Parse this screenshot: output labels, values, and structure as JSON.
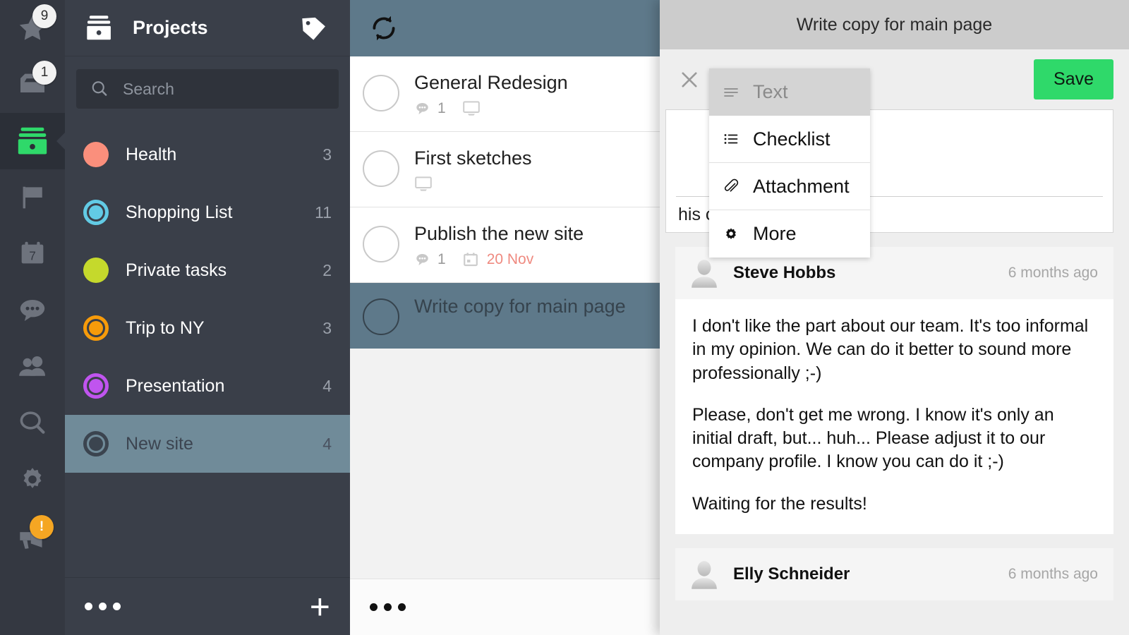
{
  "rail": {
    "items": [
      {
        "name": "starred",
        "icon": "star-icon",
        "badge": "9",
        "badge_type": "count",
        "active": false
      },
      {
        "name": "inbox",
        "icon": "inbox-icon",
        "badge": "1",
        "badge_type": "count",
        "active": false
      },
      {
        "name": "projects",
        "icon": "projects-icon",
        "badge": "",
        "badge_type": "",
        "active": true
      },
      {
        "name": "flags",
        "icon": "flag-icon",
        "badge": "",
        "badge_type": "",
        "active": false
      },
      {
        "name": "calendar",
        "icon": "calendar-icon",
        "badge": "7",
        "badge_type": "inline",
        "active": false
      },
      {
        "name": "chat",
        "icon": "comment-icon",
        "badge": "",
        "badge_type": "",
        "active": false
      },
      {
        "name": "contacts",
        "icon": "people-icon",
        "badge": "",
        "badge_type": "",
        "active": false
      },
      {
        "name": "search",
        "icon": "search-icon",
        "badge": "",
        "badge_type": "",
        "active": false
      },
      {
        "name": "settings",
        "icon": "gear-icon",
        "badge": "",
        "badge_type": "",
        "active": false
      },
      {
        "name": "announcements",
        "icon": "megaphone-icon",
        "badge": "!",
        "badge_type": "warning",
        "active": false
      }
    ],
    "calendar_day": "7"
  },
  "sidebar": {
    "title": "Projects",
    "header_icon": "projects-box-icon",
    "tag_icon": "tag-icon",
    "search": {
      "placeholder": "Search",
      "value": "",
      "icon": "search-icon"
    },
    "projects": [
      {
        "label": "Health",
        "count": "3",
        "color": "#fa8f7c",
        "style": "solid",
        "selected": false
      },
      {
        "label": "Shopping List",
        "count": "11",
        "color": "#62cbe5",
        "style": "ring",
        "selected": false
      },
      {
        "label": "Private tasks",
        "count": "2",
        "color": "#c5d92c",
        "style": "solid",
        "selected": false
      },
      {
        "label": "Trip to NY",
        "count": "3",
        "color": "#f79b0a",
        "style": "ring",
        "selected": false
      },
      {
        "label": "Presentation",
        "count": "4",
        "color": "#c054ef",
        "style": "ring",
        "selected": false
      },
      {
        "label": "New site",
        "count": "4",
        "color": "#3b444f",
        "style": "ring",
        "selected": true
      }
    ],
    "footer": {
      "more_icon": "more-dots-icon",
      "add_icon": "plus-icon"
    }
  },
  "tasklist": {
    "header_icon": "sync-icon",
    "footer_icon": "more-dots-icon",
    "tasks": [
      {
        "title": "General Redesign",
        "selected": false,
        "comment_icon": "comment-icon",
        "comment_count": "1",
        "device_icon": "monitor-icon",
        "has_device": true,
        "due_icon": "",
        "due": ""
      },
      {
        "title": "First sketches",
        "selected": false,
        "comment_icon": "",
        "comment_count": "",
        "device_icon": "monitor-icon",
        "has_device": true,
        "due_icon": "",
        "due": ""
      },
      {
        "title": "Publish the new site",
        "selected": false,
        "comment_icon": "comment-icon",
        "comment_count": "1",
        "device_icon": "",
        "has_device": false,
        "due_icon": "calendar-icon",
        "due": "20 Nov"
      },
      {
        "title": "Write copy for main page",
        "selected": true,
        "comment_icon": "",
        "comment_count": "",
        "device_icon": "",
        "has_device": false,
        "due_icon": "",
        "due": ""
      }
    ]
  },
  "detail": {
    "title": "Write copy for main page",
    "close_icon": "close-icon",
    "save_label": "Save",
    "editor": {
      "hint_text": "his comment",
      "value": ""
    },
    "dropdown": {
      "open": true,
      "items": [
        {
          "label": "Text",
          "icon": "text-lines-icon",
          "current": true
        },
        {
          "label": "Checklist",
          "icon": "checklist-icon",
          "current": false
        },
        {
          "label": "Attachment",
          "icon": "paperclip-icon",
          "current": false
        },
        {
          "label": "More",
          "icon": "gear-icon",
          "current": false
        }
      ]
    },
    "comments": [
      {
        "author": "Steve Hobbs",
        "time": "6 months ago",
        "avatar_icon": "avatar-icon",
        "paragraphs": [
          "I don't like the part about our team. It's too informal in my opinion. We can do it better to sound more professionally ;-)",
          "Please, don't get me wrong. I know it's only an initial draft, but... huh... Please adjust it to our company profile. I know you can do it ;-)",
          "Waiting for the results!"
        ]
      },
      {
        "author": "Elly Schneider",
        "time": "6 months ago",
        "avatar_icon": "avatar-icon",
        "paragraphs": []
      }
    ]
  },
  "colors": {
    "rail_bg": "#343841",
    "sidebar_bg": "#3a3f49",
    "accent_selected": "#5e798a",
    "sidebar_selected": "#708b99",
    "save_green": "#2fd96a",
    "badge_warn": "#f5a623",
    "due_red": "#ef8a80",
    "detail_titlebar": "#cccccc",
    "detail_bg": "#eeeeee"
  }
}
